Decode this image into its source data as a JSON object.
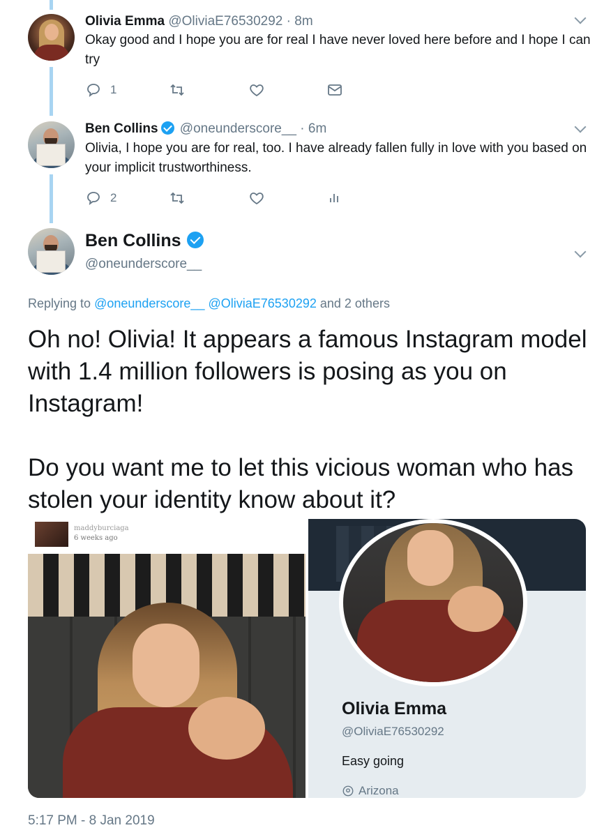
{
  "thread": [
    {
      "name": "Olivia Emma",
      "handle": "@OliviaE76530292",
      "dot": "·",
      "time": "8m",
      "verified": false,
      "text": "Okay good and I hope you are for real I have never loved here before and I hope I can try",
      "reply_count": "1",
      "icons": [
        "reply-icon",
        "retweet-icon",
        "like-icon",
        "message-icon"
      ]
    },
    {
      "name": "Ben Collins",
      "handle": "@oneunderscore__",
      "dot": "·",
      "time": "6m",
      "verified": true,
      "text": "Olivia, I hope you are for real, too. I have already fallen fully in love with you based on your implicit trustworthiness.",
      "reply_count": "2",
      "icons": [
        "reply-icon",
        "retweet-icon",
        "like-icon",
        "analytics-icon"
      ]
    }
  ],
  "main": {
    "name": "Ben Collins",
    "handle": "@oneunderscore__",
    "replying_prefix": "Replying to",
    "replying_user1": "@oneunderscore__",
    "replying_user2": "@OliviaE76530292",
    "replying_suffix": "and 2 others",
    "text_p1": "Oh no! Olivia! It appears a famous Instagram model with 1.4 million followers is posing as you on Instagram!",
    "text_p2": "Do you want me to let this vicious woman who has stolen your identity know about it?",
    "timestamp": "5:17 PM - 8 Jan 2019"
  },
  "media": {
    "left": {
      "insta_username": "maddyburciaga",
      "insta_ago": "6 weeks ago"
    },
    "right": {
      "profile_name": "Olivia Emma",
      "profile_handle": "@OliviaE76530292",
      "profile_bio": "Easy going",
      "profile_location": "Arizona"
    }
  },
  "colors": {
    "accent": "#1da1f2",
    "thread_line": "#a8d4f2",
    "muted": "#657786"
  }
}
